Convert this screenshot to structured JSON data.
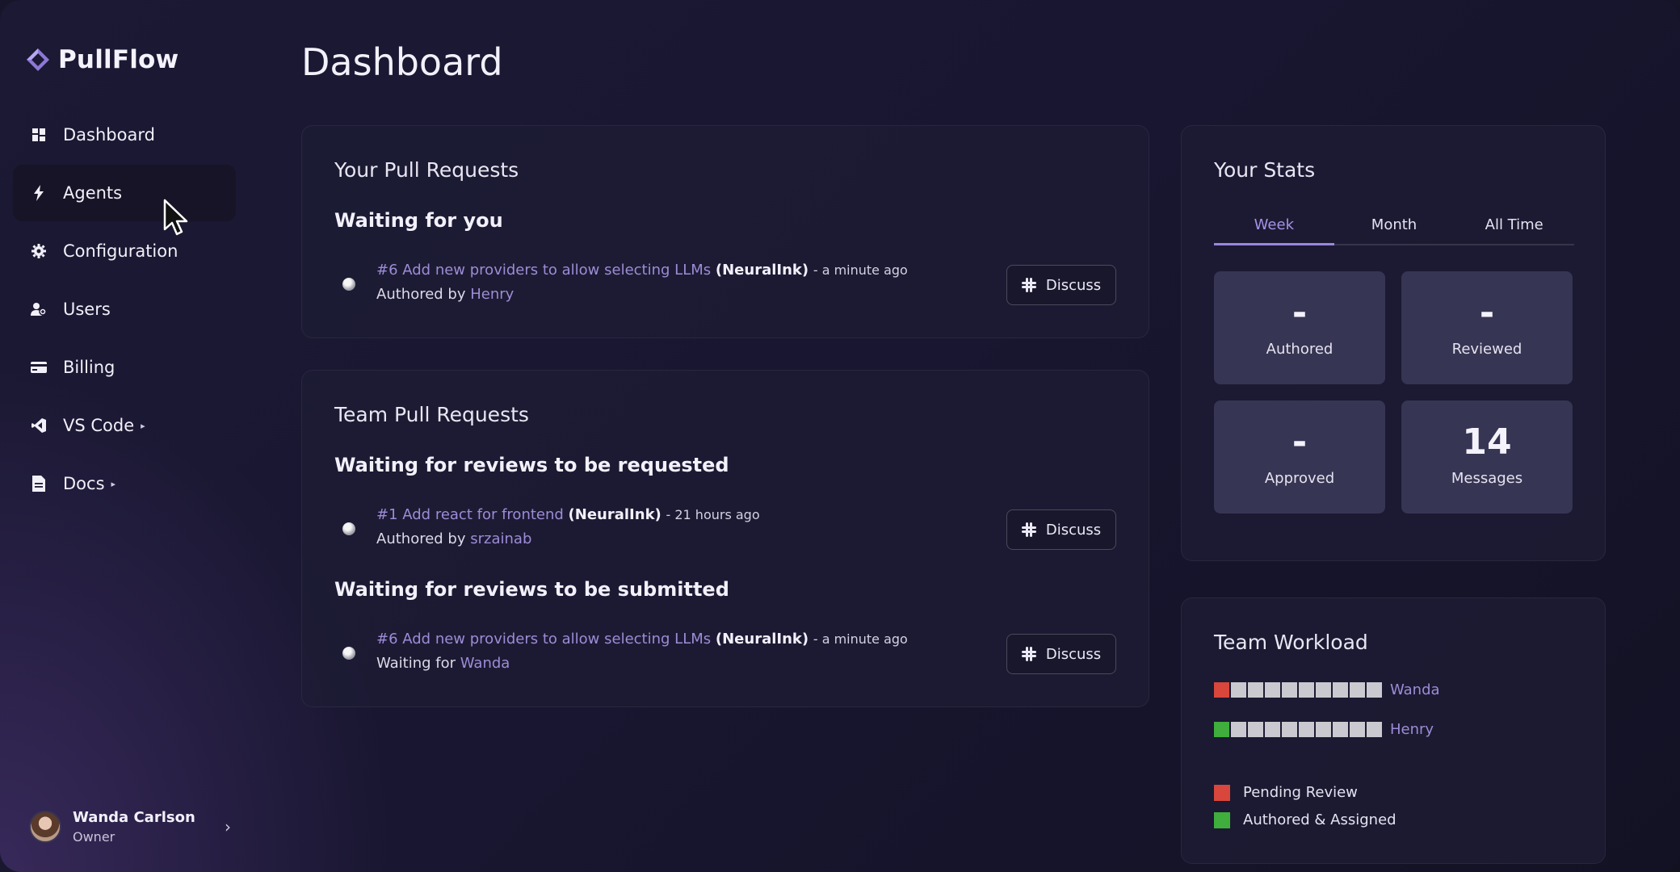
{
  "app": {
    "name": "PullFlow"
  },
  "sidebar": {
    "items": [
      {
        "label": "Dashboard",
        "icon": "grid-icon",
        "caret": ""
      },
      {
        "label": "Agents",
        "icon": "bolt-icon",
        "caret": ""
      },
      {
        "label": "Configuration",
        "icon": "gear-icon",
        "caret": ""
      },
      {
        "label": "Users",
        "icon": "users-icon",
        "caret": ""
      },
      {
        "label": "Billing",
        "icon": "card-icon",
        "caret": ""
      },
      {
        "label": "VS Code",
        "icon": "vscode-icon",
        "caret": "▸"
      },
      {
        "label": "Docs",
        "icon": "document-icon",
        "caret": "▸"
      }
    ],
    "active_index": 1
  },
  "user": {
    "name": "Wanda Carlson",
    "role": "Owner"
  },
  "page": {
    "title": "Dashboard"
  },
  "your_prs": {
    "title": "Your Pull Requests",
    "section": "Waiting for you",
    "items": [
      {
        "link": "#6 Add new providers to allow selecting LLMs",
        "repo": "(NeuralInk)",
        "time": "- a minute ago",
        "prefix": "Authored by",
        "user": "Henry",
        "button": "Discuss"
      }
    ]
  },
  "team_prs": {
    "title": "Team Pull Requests",
    "sections": [
      {
        "title": "Waiting for reviews to be requested",
        "items": [
          {
            "link": "#1 Add react for frontend",
            "repo": "(NeuralInk)",
            "time": "- 21 hours ago",
            "prefix": "Authored by",
            "user": "srzainab",
            "button": "Discuss"
          }
        ]
      },
      {
        "title": "Waiting for reviews to be submitted",
        "items": [
          {
            "link": "#6 Add new providers to allow selecting LLMs",
            "repo": "(NeuralInk)",
            "time": "- a minute ago",
            "prefix": "Waiting for",
            "user": "Wanda",
            "button": "Discuss"
          }
        ]
      }
    ]
  },
  "stats": {
    "title": "Your Stats",
    "tabs": [
      "Week",
      "Month",
      "All Time"
    ],
    "active_tab": "Week",
    "boxes": [
      {
        "value": "-",
        "label": "Authored"
      },
      {
        "value": "-",
        "label": "Reviewed"
      },
      {
        "value": "-",
        "label": "Approved"
      },
      {
        "value": "14",
        "label": "Messages"
      }
    ]
  },
  "workload": {
    "title": "Team Workload",
    "members": [
      {
        "name": "Wanda",
        "pending": 1,
        "authored": 0,
        "total": 10
      },
      {
        "name": "Henry",
        "pending": 0,
        "authored": 1,
        "total": 10
      }
    ],
    "legend": [
      {
        "label": "Pending Review",
        "color": "#d9463b"
      },
      {
        "label": "Authored & Assigned",
        "color": "#3fae3c"
      }
    ],
    "empty_color": "#c9c9cf"
  },
  "colors": {
    "accent": "#9d8cd6",
    "tab_active": "#a593e6"
  }
}
